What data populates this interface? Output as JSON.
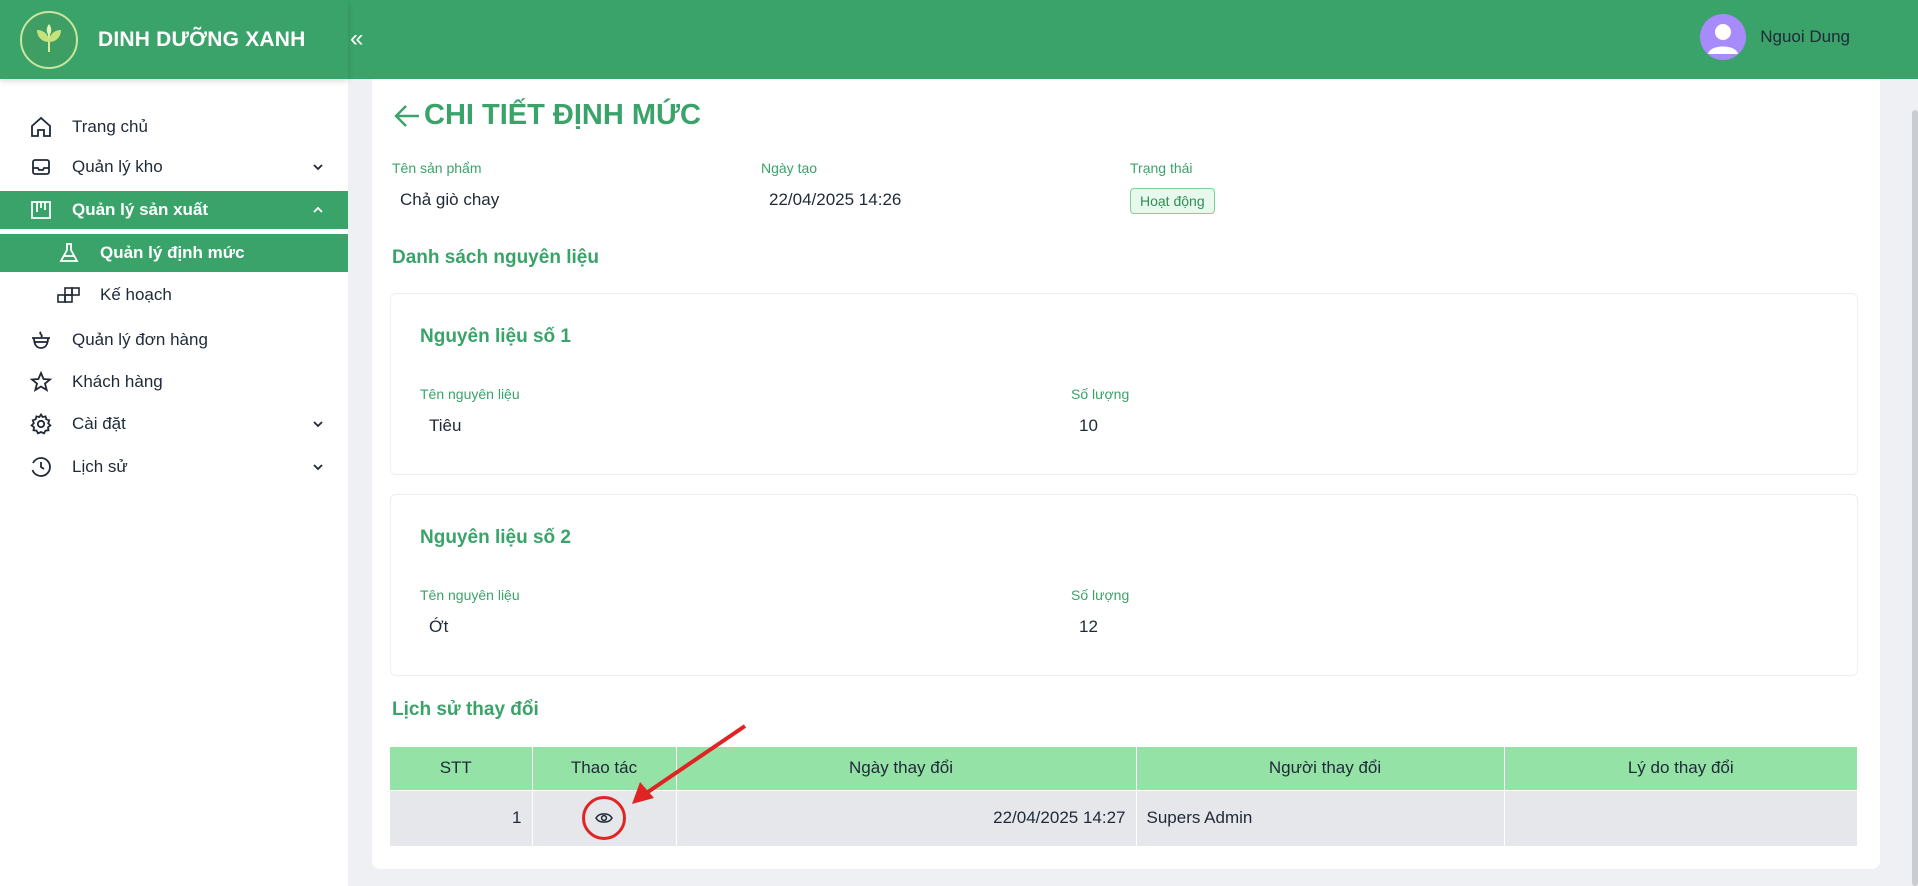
{
  "brand": {
    "name": "DINH DƯỠNG XANH"
  },
  "header": {
    "collapse_icon": "«",
    "user_name": "Nguoi Dung"
  },
  "sidebar": {
    "items": [
      {
        "label": "Trang chủ"
      },
      {
        "label": "Quản lý kho"
      },
      {
        "label": "Quản lý sản xuất"
      },
      {
        "label": "Quản lý định mức"
      },
      {
        "label": "Kế hoạch"
      },
      {
        "label": "Quản lý đơn hàng"
      },
      {
        "label": "Khách hàng"
      },
      {
        "label": "Cài đặt"
      },
      {
        "label": "Lịch sử"
      }
    ]
  },
  "page": {
    "title": "CHI TIẾT ĐỊNH MỨC",
    "product_label": "Tên sản phẩm",
    "product_value": "Chả giò chay",
    "created_label": "Ngày tạo",
    "created_value": "22/04/2025 14:26",
    "status_label": "Trạng thái",
    "status_value": "Hoạt động",
    "materials_title": "Danh sách nguyên liệu",
    "materials": [
      {
        "title": "Nguyên liệu số 1",
        "name_label": "Tên nguyên liệu",
        "name": "Tiêu",
        "qty_label": "Số lượng",
        "qty": "10"
      },
      {
        "title": "Nguyên liệu số 2",
        "name_label": "Tên nguyên liệu",
        "name": "Ớt",
        "qty_label": "Số lượng",
        "qty": "12"
      }
    ],
    "history_title": "Lịch sử thay đổi",
    "history_columns": [
      "STT",
      "Thao tác",
      "Ngày thay đổi",
      "Người thay đổi",
      "Lý do thay đổi"
    ],
    "history_rows": [
      {
        "stt": "1",
        "date": "22/04/2025 14:27",
        "user": "Supers Admin",
        "reason": ""
      }
    ]
  },
  "colors": {
    "primary": "#3aa36a",
    "table_header": "#95e2a6",
    "annotation": "#e02424"
  }
}
